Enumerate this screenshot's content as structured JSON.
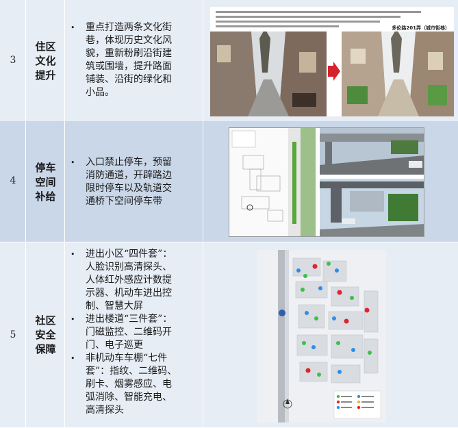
{
  "rows": [
    {
      "num": "3",
      "name": [
        "住区",
        "文化",
        "提升"
      ],
      "bullets": [
        [
          "重点打造两条文化街",
          "巷，体现历史文化风",
          "貌，重新粉刷沿街建",
          "筑或围墙，提升路面",
          "铺装、沿街的绿化和",
          "小品。"
        ]
      ],
      "image_caption": "多伦路201弄（城市街巷）"
    },
    {
      "num": "4",
      "name": [
        "停车",
        "空间",
        "补给"
      ],
      "bullets": [
        [
          "入口禁止停车，预留",
          "消防通道，开辟路边",
          "限时停车以及轨道交",
          "通桥下空间停车带"
        ]
      ]
    },
    {
      "num": "5",
      "name": [
        "社区",
        "安全",
        "保障"
      ],
      "bullets": [
        [
          "进出小区“四件套”：",
          "人脸识别高清探头、",
          "人体红外感应计数提",
          "示器、机动车进出控",
          "制、智慧大屏"
        ],
        [
          "进出楼道“三件套”：",
          "门磁监控、二维码开",
          "门、电子巡更"
        ],
        [
          "非机动车车棚“七件",
          "套”：指纹、二维码、",
          "刷卡、烟雾感应、电",
          "弧消除、智能充电、",
          "高清探头"
        ]
      ]
    }
  ],
  "bullet_symbol": "•",
  "colors": {
    "row_light": "#e7edf5",
    "row_dark": "#c9d7e8",
    "marker_red": "#e0232d",
    "marker_blue": "#2f8de4",
    "marker_green": "#3cc04a"
  }
}
